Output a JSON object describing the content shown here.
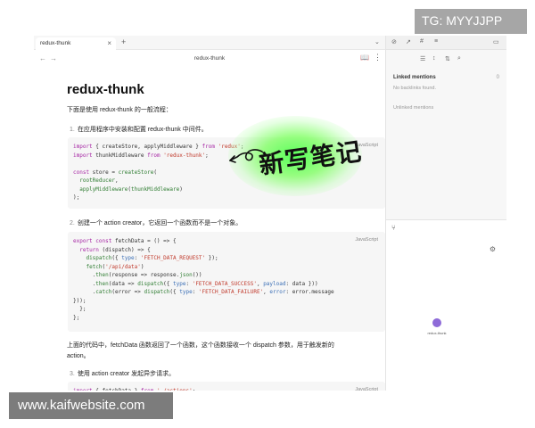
{
  "watermarks": {
    "telegram": "TG: MYYJJPP",
    "website": "www.kaifwebsite.com"
  },
  "tabs": {
    "active_tab": "redux-thunk",
    "close_glyph": "×",
    "new_tab_glyph": "+",
    "chevron_glyph": "⌄"
  },
  "note": {
    "header_title": "redux-thunk",
    "back_glyph": "←",
    "forward_glyph": "→",
    "reading_view_icon": "book-icon",
    "reading_glyph": "📖",
    "more_glyph": "⋮",
    "title": "redux-thunk",
    "intro": "下面是使用 redux-thunk 的一般流程：",
    "steps": [
      {
        "num": "1.",
        "text": "在应用程序中安装和配置 redux-thunk 中间件。"
      },
      {
        "num": "2.",
        "text": "创建一个 action creator，它返回一个函数而不是一个对象。"
      },
      {
        "num": "3.",
        "text": "使用 action creator 发起异步请求。"
      }
    ],
    "explanation_line1": "上面的代码中，fetchData 函数返回了一个函数，这个函数接收一个 dispatch 参数，用于触发新的",
    "explanation_line2": "action。",
    "code_language": "JavaScript"
  },
  "code_blocks": {
    "block1": [
      "import { createStore, applyMiddleware } from 'redux';",
      "import thunkMiddleware from 'redux-thunk';",
      "",
      "const store = createStore(",
      "  rootReducer,",
      "  applyMiddleware(thunkMiddleware)",
      ");"
    ],
    "block2": [
      "export const fetchData = () => {",
      "  return (dispatch) => {",
      "    dispatch({ type: 'FETCH_DATA_REQUEST' });",
      "    fetch('/api/data')",
      "      .then(response => response.json())",
      "      .then(data => dispatch({ type: 'FETCH_DATA_SUCCESS', payload: data }))",
      "      .catch(error => dispatch({ type: 'FETCH_DATA_FAILURE', error: error.message",
      "}));",
      "  };",
      "};"
    ],
    "block3": [
      "import { fetchData } from './actions';"
    ]
  },
  "sticker": {
    "text": "新写笔记",
    "accent_color": "#4cff4c"
  },
  "sidebar": {
    "top_icons": [
      "backlinks-icon",
      "outgoing-links-icon",
      "tag-icon",
      "outline-icon",
      "sidebar-toggle-icon"
    ],
    "top_glyphs": [
      "⊘",
      "↗",
      "#",
      "≡",
      "▭"
    ],
    "toolbar_icons": [
      "list-icon",
      "sort-icon",
      "filter-icon",
      "search-icon"
    ],
    "toolbar_glyphs": [
      "☰",
      "↕",
      "⇅",
      "⌕"
    ],
    "linked_mentions": "Linked mentions",
    "linked_count": "0",
    "no_backlinks": "No backlinks found.",
    "unlinked_mentions": "Unlinked mentions",
    "graph_icon": "graph-icon",
    "graph_glyph": "⑂",
    "settings_glyph": "⚙",
    "graph_node_label": "redux-thunk",
    "node_color": "#8e6bd8"
  }
}
